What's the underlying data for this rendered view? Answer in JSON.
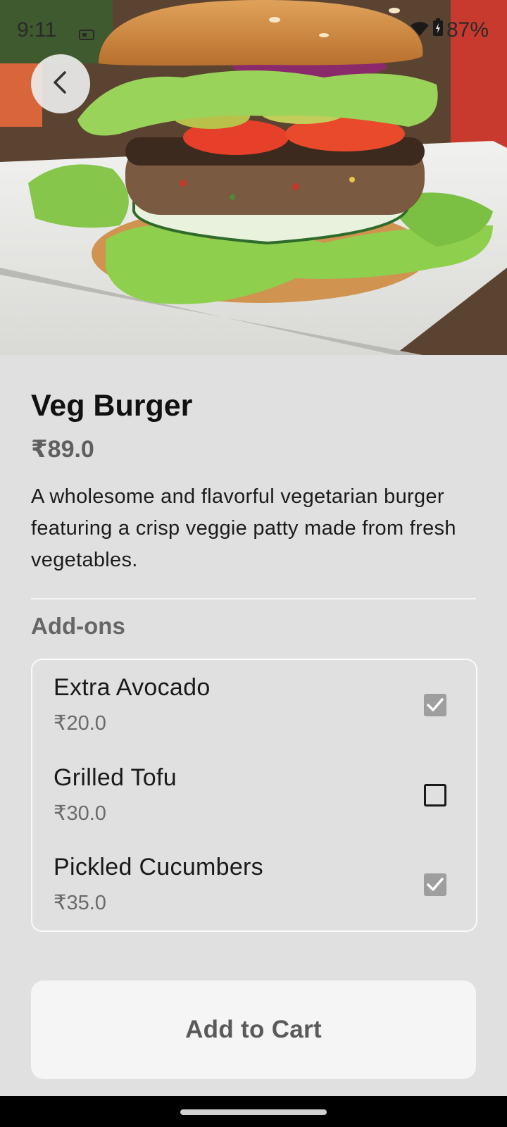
{
  "status_bar": {
    "time": "9:11",
    "battery": "87%",
    "icons": [
      "sim-icon",
      "wifi-icon",
      "battery-icon"
    ]
  },
  "header": {
    "back_icon": "chevron-left-icon"
  },
  "product": {
    "name": "Veg Burger",
    "price": "₹89.0",
    "description": "A wholesome and flavorful vegetarian burger featuring a crisp veggie patty made from fresh vegetables."
  },
  "addons": {
    "title": "Add-ons",
    "items": [
      {
        "name": "Extra Avocado",
        "price": "₹20.0",
        "checked": true
      },
      {
        "name": "Grilled Tofu",
        "price": "₹30.0",
        "checked": false
      },
      {
        "name": "Pickled Cucumbers",
        "price": "₹35.0",
        "checked": true
      }
    ]
  },
  "cart": {
    "button_label": "Add to Cart"
  },
  "colors": {
    "background": "#e0e0e0",
    "checkbox_checked": "#9e9e9e",
    "button_bg": "#f5f5f5"
  }
}
